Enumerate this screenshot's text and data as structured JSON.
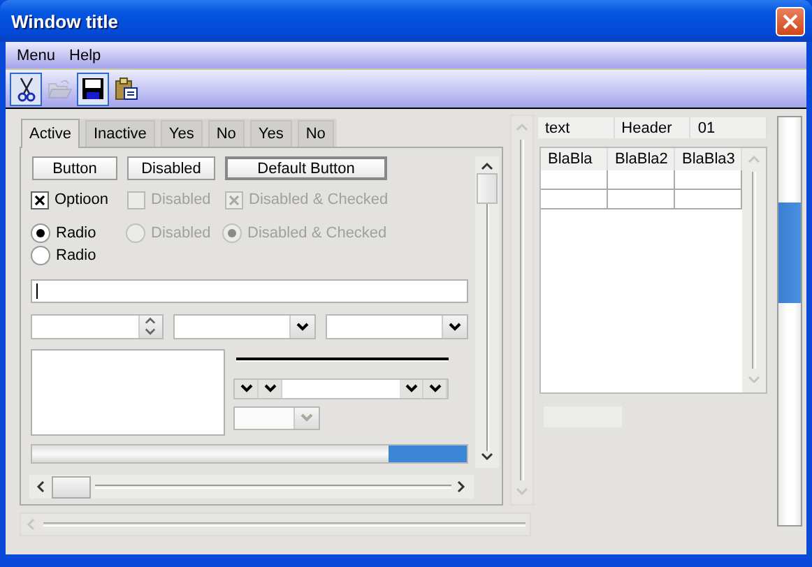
{
  "window": {
    "title": "Window title"
  },
  "menu": [
    {
      "label": "Menu"
    },
    {
      "label": "Help"
    }
  ],
  "toolbar": [
    {
      "kind": "cut",
      "selected": true,
      "disabled": false
    },
    {
      "kind": "open",
      "selected": false,
      "disabled": true
    },
    {
      "kind": "save",
      "selected": true,
      "disabled": false
    },
    {
      "kind": "paste",
      "selected": false,
      "disabled": false
    }
  ],
  "tabs": [
    {
      "label": "Active",
      "selected": true
    },
    {
      "label": "Inactive",
      "selected": false
    },
    {
      "label": "Yes",
      "selected": false
    },
    {
      "label": "No",
      "selected": false
    },
    {
      "label": "Yes",
      "selected": false
    },
    {
      "label": "No",
      "selected": false
    }
  ],
  "buttons": [
    {
      "label": "Button",
      "default": false
    },
    {
      "label": "Disabled",
      "default": false
    },
    {
      "label": "Default Button",
      "default": true
    }
  ],
  "checkboxes": [
    {
      "label": "Optioon",
      "checked": true,
      "disabled": false
    },
    {
      "label": "Disabled",
      "checked": false,
      "disabled": true
    },
    {
      "label": "Disabled & Checked",
      "checked": true,
      "disabled": true
    }
  ],
  "radios": [
    {
      "label": "Radio",
      "selected": true,
      "disabled": false
    },
    {
      "label": "Disabled",
      "selected": false,
      "disabled": true
    },
    {
      "label": "Disabled & Checked",
      "selected": true,
      "disabled": true
    },
    {
      "label": "Radio",
      "selected": false,
      "disabled": false
    }
  ],
  "small_combo": {
    "disabled": true
  },
  "progress": {
    "level": 0.18
  },
  "header_bar": [
    "text",
    "Header",
    "01"
  ],
  "table": {
    "columns": [
      "BlaBla",
      "BlaBla2",
      "BlaBla3"
    ]
  }
}
